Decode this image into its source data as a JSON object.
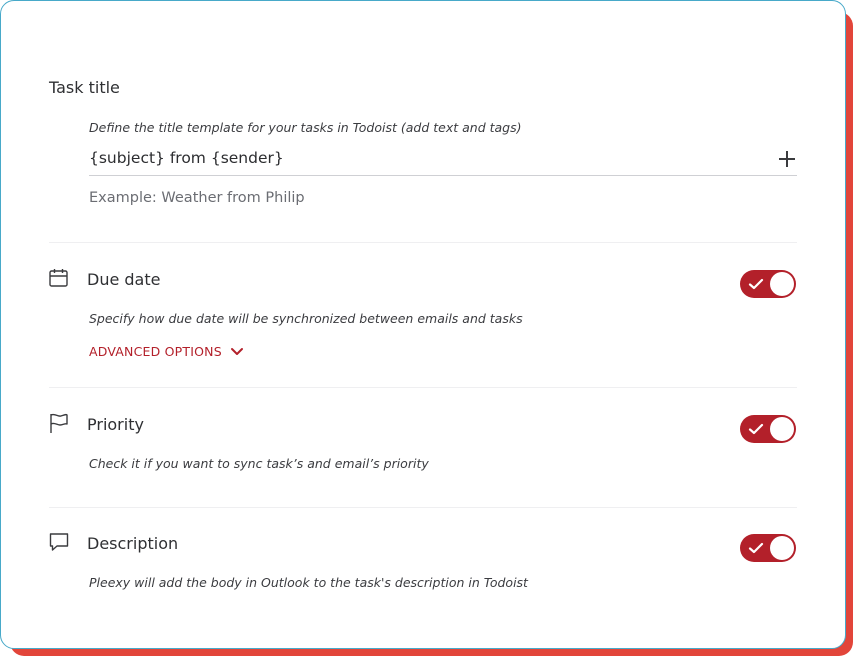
{
  "colors": {
    "accent": "#b3202a",
    "card_border": "#47a9c9",
    "card_shadow": "#e2453a",
    "text": "#2f3033",
    "muted": "#6b6d73"
  },
  "task_title": {
    "heading": "Task title",
    "hint": "Define the title template for your tasks in Todoist (add text and tags)",
    "template_value": "{subject} from {sender}",
    "add_tag_icon": "plus-icon",
    "example": "Example: Weather from Philip"
  },
  "due_date": {
    "icon": "calendar-icon",
    "heading": "Due date",
    "hint": "Specify how due date will be synchronized between emails and tasks",
    "advanced_label": "ADVANCED OPTIONS",
    "advanced_icon": "chevron-down-icon",
    "enabled": true
  },
  "priority": {
    "icon": "flag-icon",
    "heading": "Priority",
    "hint": "Check it if you want to sync task’s and email’s priority",
    "enabled": true
  },
  "description": {
    "icon": "comment-icon",
    "heading": "Description",
    "hint": "Pleexy will add the body in Outlook to the task's description in Todoist",
    "enabled": true
  }
}
